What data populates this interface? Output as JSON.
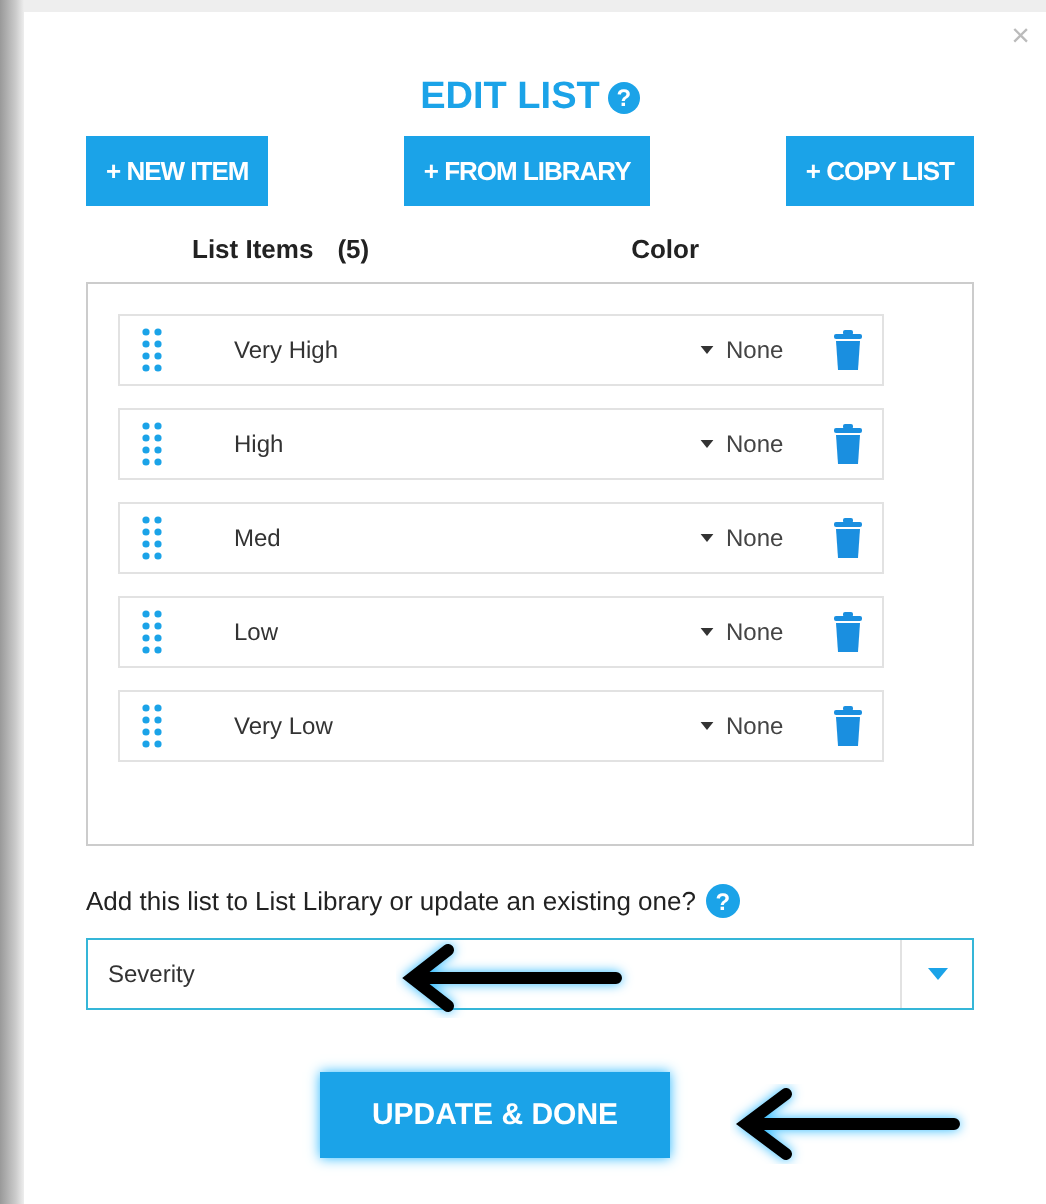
{
  "dialog": {
    "close": "×",
    "title": "EDIT LIST",
    "help": "?"
  },
  "actions": [
    "+ NEW ITEM",
    "+ FROM LIBRARY",
    "+ COPY LIST"
  ],
  "list": {
    "items_header": "List Items",
    "count": "(5)",
    "color_header": "Color",
    "items": [
      {
        "name": "Very High",
        "color_choice": "None"
      },
      {
        "name": "High",
        "color_choice": "None"
      },
      {
        "name": "Med",
        "color_choice": "None"
      },
      {
        "name": "Low",
        "color_choice": "None"
      },
      {
        "name": "Very Low",
        "color_choice": "None"
      }
    ]
  },
  "library": {
    "question": "Add this list to List Library or update an existing one?",
    "help": "?",
    "value": "Severity"
  },
  "submit": "UPDATE & DONE"
}
